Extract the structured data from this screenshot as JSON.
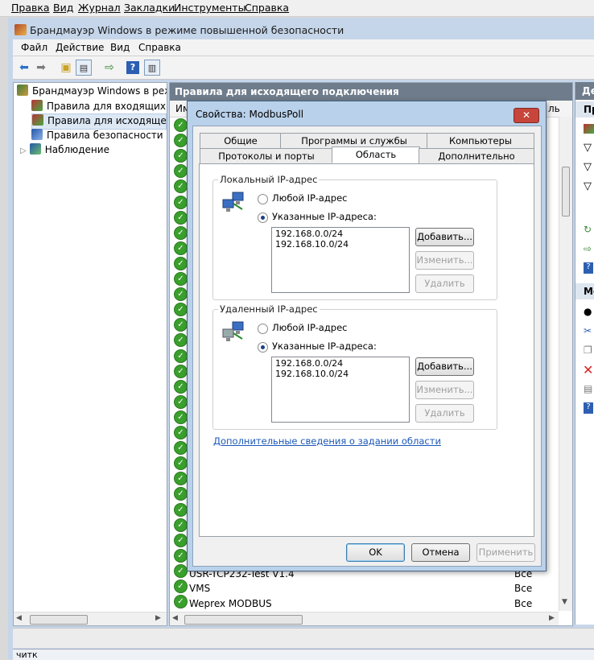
{
  "outer_menu": [
    "Правка",
    "Вид",
    "Журнал",
    "Закладки",
    "Инструменты",
    "Справка"
  ],
  "mmc": {
    "title": "Брандмауэр Windows в режиме повышенной безопасности",
    "menu": [
      "Файл",
      "Действие",
      "Вид",
      "Справка"
    ],
    "toolbar_icons": [
      "back-icon",
      "forward-icon",
      "up-folder-icon",
      "show-tree-icon",
      "export-icon",
      "help-icon",
      "properties-icon"
    ]
  },
  "tree": {
    "items": [
      {
        "label": "Брандмауэр Windows в режим",
        "icon": "firewall-icon"
      },
      {
        "label": "Правила для входящих по",
        "icon": "inbound-rules-icon"
      },
      {
        "label": "Правила для исходящего п",
        "icon": "outbound-rules-icon"
      },
      {
        "label": "Правила безопасности по",
        "icon": "security-rules-icon"
      },
      {
        "label": "Наблюдение",
        "icon": "monitoring-icon"
      }
    ],
    "expander": "▷"
  },
  "list": {
    "header": "Правила для исходящего подключения",
    "column_name_partial": "Им",
    "column_profile_partial": "ль",
    "visible_rows": [
      {
        "name": "USR-TCP232-Test V1.4",
        "profile": "Все"
      },
      {
        "name": "VMS",
        "profile": "Все"
      },
      {
        "name": "Weprex MODBUS",
        "profile": "Все"
      }
    ]
  },
  "actions": {
    "header_partial": "Де",
    "subheader_partial": "Пр",
    "section2_partial": "Мо"
  },
  "dialog": {
    "title": "Свойства: ModbusPoll",
    "close_glyph": "✕",
    "tabs_row1": [
      "Общие",
      "Программы и службы",
      "Компьютеры"
    ],
    "tabs_row2": [
      "Протоколы и порты",
      "Область",
      "Дополнительно"
    ],
    "active_tab": "Область",
    "local": {
      "group_label": "Локальный IP-адрес",
      "any_label": "Любой IP-адрес",
      "specified_label": "Указанные IP-адреса:",
      "selected": "specified",
      "addresses": [
        "192.168.0.0/24",
        "192.168.10.0/24"
      ],
      "add": "Добавить...",
      "edit": "Изменить...",
      "remove": "Удалить"
    },
    "remote": {
      "group_label": "Удаленный IP-адрес",
      "any_label": "Любой IP-адрес",
      "specified_label": "Указанные IP-адреса:",
      "selected": "specified",
      "addresses": [
        "192.168.0.0/24",
        "192.168.10.0/24"
      ],
      "add": "Добавить...",
      "edit": "Изменить...",
      "remove": "Удалить"
    },
    "link": "Дополнительные сведения о задании области",
    "ok": "OK",
    "cancel": "Отмена",
    "apply": "Применить"
  },
  "taskbar_partial": "читк"
}
